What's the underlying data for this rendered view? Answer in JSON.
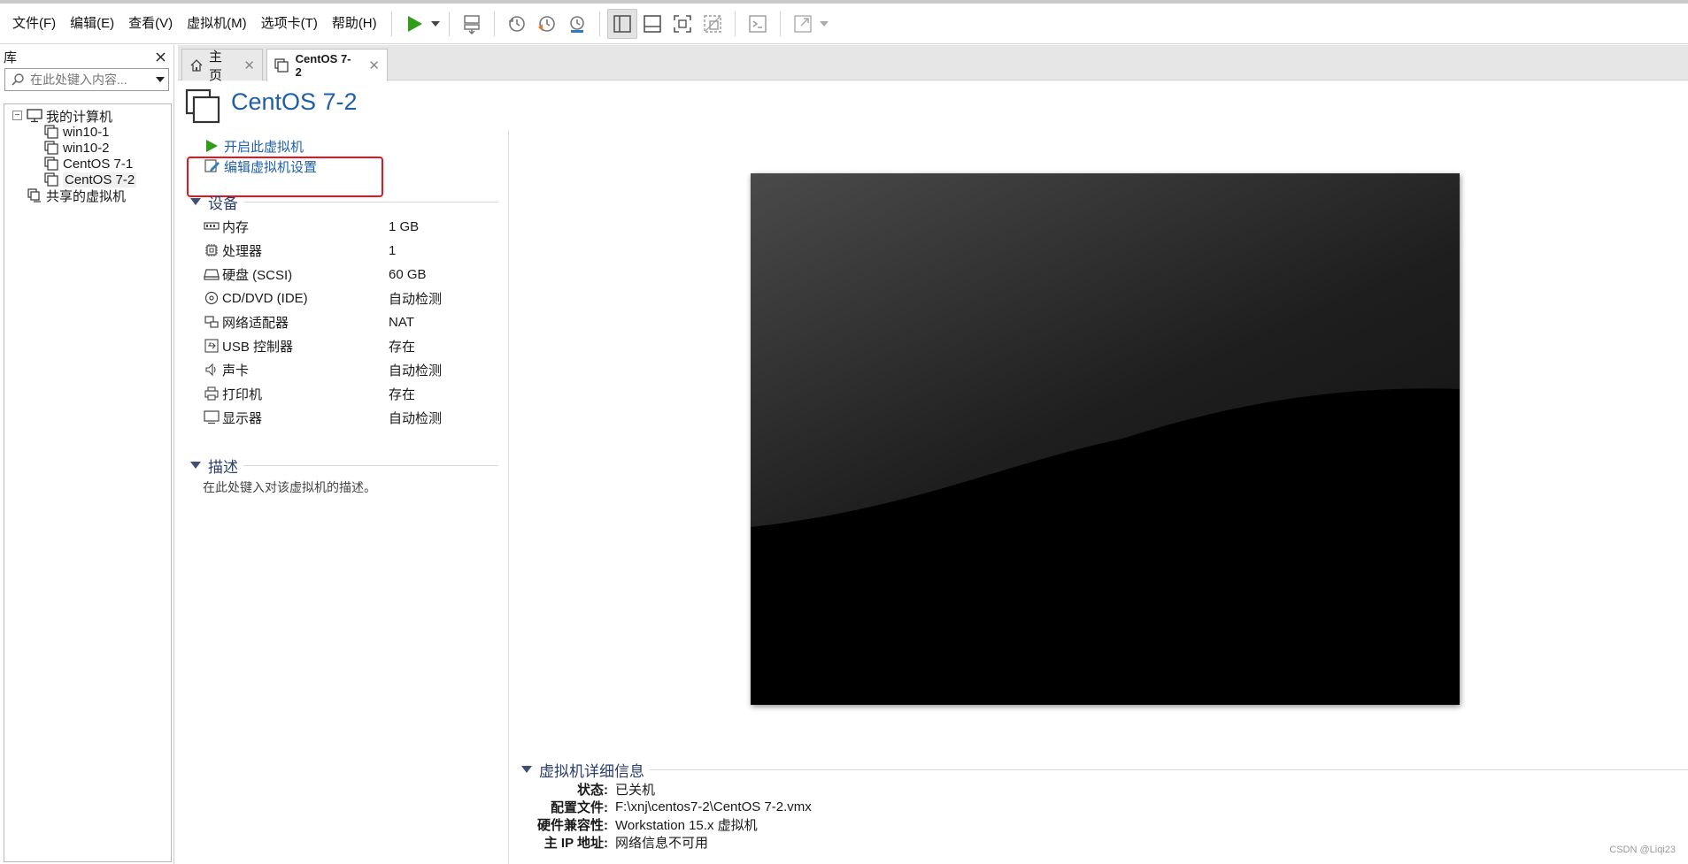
{
  "menubar": {
    "items": [
      "文件(F)",
      "编辑(E)",
      "查看(V)",
      "虚拟机(M)",
      "选项卡(T)",
      "帮助(H)"
    ]
  },
  "toolbar": {
    "icons": [
      "play-icon",
      "send-ctrl-alt-del-icon",
      "snapshot-icon",
      "revert-snapshot-icon",
      "snapshot-manager-icon",
      "library-view-icon",
      "thumbnail-bar-icon",
      "full-screen-icon",
      "unity-icon",
      "console-icon",
      "stretch-icon"
    ],
    "accent_green": "#2e9e16"
  },
  "library": {
    "title": "库",
    "search_placeholder": "在此处键入内容...",
    "tree": {
      "root": "我的计算机",
      "vms": [
        "win10-1",
        "win10-2",
        "CentOS 7-1",
        "CentOS 7-2"
      ],
      "shared": "共享的虚拟机",
      "selected": "CentOS 7-2"
    }
  },
  "tabs": [
    {
      "label": "主页",
      "icon": "home-icon"
    },
    {
      "label": "CentOS 7-2",
      "icon": "vm-icon",
      "active": true
    }
  ],
  "vm": {
    "title": "CentOS 7-2",
    "actions": {
      "power_on": "开启此虚拟机",
      "edit_settings": "编辑虚拟机设置"
    },
    "devices_header": "设备",
    "devices": [
      {
        "name": "内存",
        "value": "1 GB",
        "icon": "memory-icon"
      },
      {
        "name": "处理器",
        "value": "1",
        "icon": "cpu-icon"
      },
      {
        "name": "硬盘 (SCSI)",
        "value": "60 GB",
        "icon": "hard-disk-icon"
      },
      {
        "name": "CD/DVD (IDE)",
        "value": "自动检测",
        "icon": "cd-dvd-icon"
      },
      {
        "name": "网络适配器",
        "value": "NAT",
        "icon": "network-adapter-icon"
      },
      {
        "name": "USB 控制器",
        "value": "存在",
        "icon": "usb-icon"
      },
      {
        "name": "声卡",
        "value": "自动检测",
        "icon": "sound-icon"
      },
      {
        "name": "打印机",
        "value": "存在",
        "icon": "printer-icon"
      },
      {
        "name": "显示器",
        "value": "自动检测",
        "icon": "display-icon"
      }
    ],
    "description_header": "描述",
    "description_placeholder": "在此处键入对该虚拟机的描述。",
    "details_header": "虚拟机详细信息",
    "details": [
      {
        "key": "状态:",
        "value": "已关机"
      },
      {
        "key": "配置文件:",
        "value": "F:\\xnj\\centos7-2\\CentOS 7-2.vmx"
      },
      {
        "key": "硬件兼容性:",
        "value": "Workstation 15.x 虚拟机"
      },
      {
        "key": "主 IP 地址:",
        "value": "网络信息不可用"
      }
    ],
    "highlight_color": "#e8141e"
  },
  "watermark": "CSDN @Liqi23"
}
